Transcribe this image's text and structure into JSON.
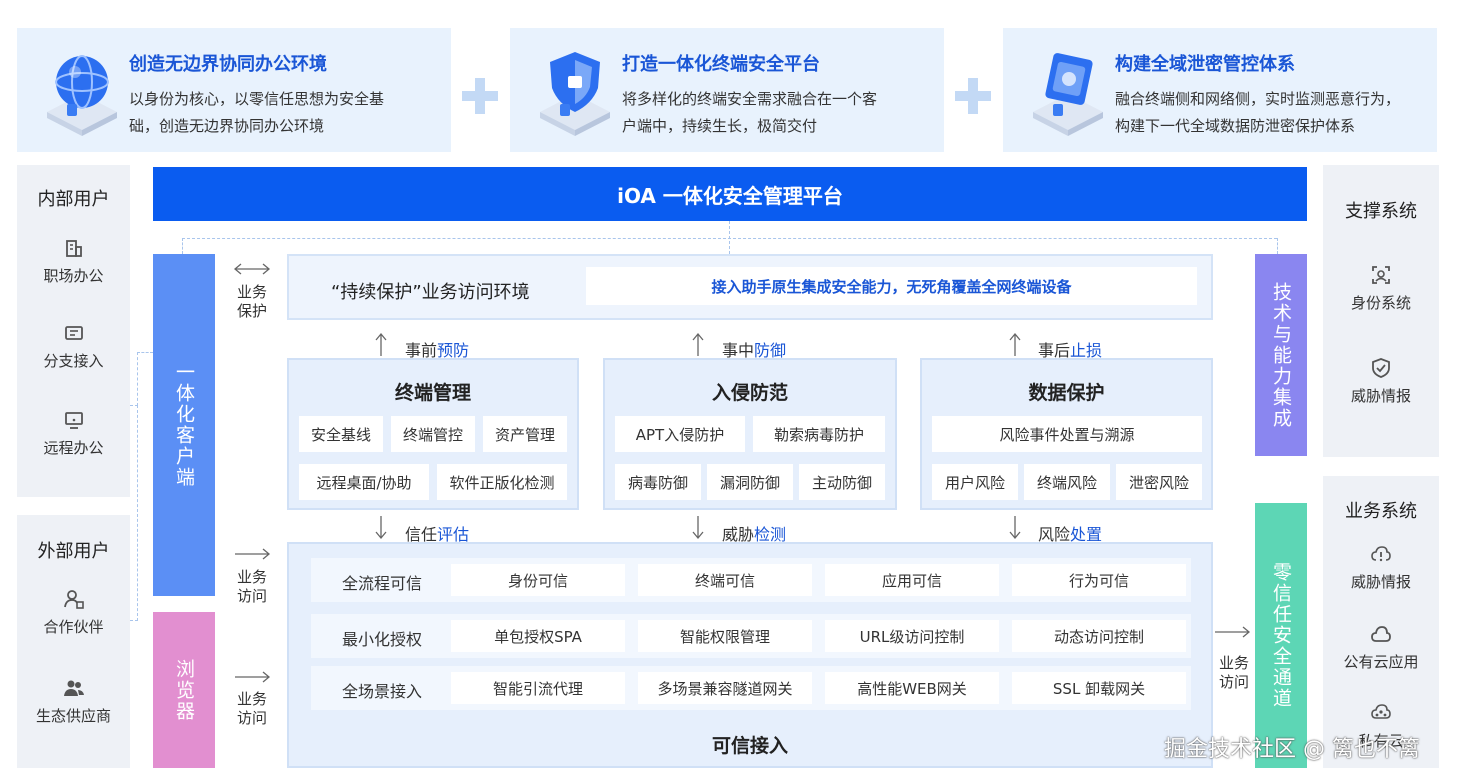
{
  "top_cards": [
    {
      "title": "创造无边界协同办公环境",
      "desc_line1": "以身份为核心，以零信任思想为安全基",
      "desc_line2": "础，创造无边界协同办公环境"
    },
    {
      "title": "打造一体化终端安全平台",
      "desc_line1": "将多样化的终端安全需求融合在一个客",
      "desc_line2": "户端中，持续生长，极简交付"
    },
    {
      "title": "构建全域泄密管控体系",
      "desc_line1": "融合终端侧和网络侧，实时监测恶意行为，",
      "desc_line2": "构建下一代全域数据防泄密保护体系"
    }
  ],
  "left": {
    "internal": {
      "title": "内部用户",
      "items": [
        {
          "label": "职场办公",
          "icon": "building-icon"
        },
        {
          "label": "分支接入",
          "icon": "branch-card-icon"
        },
        {
          "label": "远程办公",
          "icon": "monitor-icon"
        }
      ]
    },
    "external": {
      "title": "外部用户",
      "items": [
        {
          "label": "合作伙伴",
          "icon": "partner-icon"
        },
        {
          "label": "生态供应商",
          "icon": "group-icon"
        }
      ]
    }
  },
  "platform_title": "iOA 一体化安全管理平台",
  "client_bar": "一体化客户端",
  "browser_bar": "浏览器",
  "tech_bar": "技术与能力集成",
  "zt_bar": "零信任安全通道",
  "side_labels": {
    "protect": "业务保护",
    "access1": "业务访问",
    "access2": "业务访问",
    "access_right": "业务访问"
  },
  "protect": {
    "title": "“持续保护”业务访问环境",
    "highlight": "接入助手原生集成安全能力，无死角覆盖全网终端设备"
  },
  "phases_top": [
    {
      "pre": "事前",
      "hl": "预防"
    },
    {
      "pre": "事中",
      "hl": "防御"
    },
    {
      "pre": "事后",
      "hl": "止损"
    }
  ],
  "phases_bottom": [
    {
      "pre": "信任",
      "hl": "评估"
    },
    {
      "pre": "威胁",
      "hl": "检测"
    },
    {
      "pre": "风险",
      "hl": "处置"
    }
  ],
  "modules": [
    {
      "title": "终端管理",
      "row1": [
        "安全基线",
        "终端管控",
        "资产管理"
      ],
      "row2": [
        "远程桌面/协助",
        "软件正版化检测"
      ]
    },
    {
      "title": "入侵防范",
      "row1": [
        "APT入侵防护",
        "勒索病毒防护"
      ],
      "row2": [
        "病毒防御",
        "漏洞防御",
        "主动防御"
      ]
    },
    {
      "title": "数据保护",
      "row1": [
        "风险事件处置与溯源"
      ],
      "row2": [
        "用户风险",
        "终端风险",
        "泄密风险"
      ]
    }
  ],
  "access": {
    "title": "可信接入",
    "rows": [
      {
        "label": "全流程可信",
        "cells": [
          "身份可信",
          "终端可信",
          "应用可信",
          "行为可信"
        ]
      },
      {
        "label": "最小化授权",
        "cells": [
          "单包授权SPA",
          "智能权限管理",
          "URL级访问控制",
          "动态访问控制"
        ]
      },
      {
        "label": "全场景接入",
        "cells": [
          "智能引流代理",
          "多场景兼容隧道网关",
          "高性能WEB网关",
          "SSL 卸载网关"
        ]
      }
    ]
  },
  "right": {
    "support": {
      "title": "支撑系统",
      "items": [
        {
          "label": "身份系统",
          "icon": "face-scan-icon"
        },
        {
          "label": "威胁情报",
          "icon": "shield-check-icon"
        }
      ]
    },
    "business": {
      "title": "业务系统",
      "items": [
        {
          "label": "威胁情报",
          "icon": "cloud-alert-icon"
        },
        {
          "label": "公有云应用",
          "icon": "cloud-icon"
        },
        {
          "label": "私有云",
          "icon": "cloud-network-icon"
        }
      ]
    }
  },
  "watermark": "掘金技术社区 @ 篱也不篱",
  "colors": {
    "primary": "#0a5cf0",
    "accent_text": "#1a56d6",
    "client_bar": "#5b8ff5",
    "browser_bar": "#e28fd0",
    "tech_bar": "#8a86f0",
    "zt_bar": "#5dd6b5",
    "card_bg": "#e8f2fd"
  }
}
